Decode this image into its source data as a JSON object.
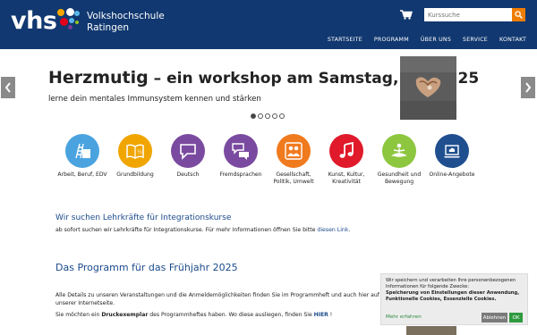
{
  "header": {
    "logo_text": "vhs",
    "school_line1": "Volkshochschule",
    "school_line2": "Ratingen",
    "search_placeholder": "Kurssuche"
  },
  "nav": {
    "items": [
      "STARTSEITE",
      "PROGRAMM",
      "ÜBER UNS",
      "SERVICE",
      "KONTAKT"
    ]
  },
  "slider": {
    "title_main": "Herzmutig",
    "title_rest": " – ein workshop am Samstag, 10.05.25",
    "subtitle": "lerne dein mentales Immunsystem kennen und stärken",
    "slide_count": 5,
    "active_slide": 1
  },
  "categories": [
    {
      "label": "Arbeit, Beruf, EDV",
      "color": "#4aa3df",
      "icon": "ladder-folder-icon"
    },
    {
      "label": "Grundbildung",
      "color": "#f0a500",
      "icon": "open-book-icon"
    },
    {
      "label": "Deutsch",
      "color": "#7a4aa0",
      "icon": "speech-bubble-icon"
    },
    {
      "label": "Fremdsprachen",
      "color": "#7a4aa0",
      "icon": "speech-bubbles-icon"
    },
    {
      "label": "Gesellschaft, Politik, Umwelt",
      "color": "#f07a1e",
      "icon": "people-icon"
    },
    {
      "label": "Kunst, Kultur, Kreativität",
      "color": "#e01a2a",
      "icon": "music-note-icon"
    },
    {
      "label": "Gesundheit und Bewegung",
      "color": "#8dc63f",
      "icon": "yoga-icon"
    },
    {
      "label": "Online-Angebote",
      "color": "#1f4f8f",
      "icon": "laptop-cloud-icon"
    }
  ],
  "teachers": {
    "title": "Wir suchen Lehrkräfte für Integrationskurse",
    "text": "ab sofort suchen wir Lehrkräfte für Integrationskurse. Für mehr Informationen öffnen Sie bitte ",
    "link": "diesen Link",
    "text_end": "."
  },
  "program": {
    "title": "Das Programm für das Frühjahr 2025",
    "text1": "Alle Details zu unseren Veranstaltungen und die Anmeldemöglichkeiten finden Sie im Programmheft und auch hier auf unserer Internetseite.",
    "text2_start": "Sie möchten ein ",
    "text2_bold": "Druckexemplar",
    "text2_mid": " des Programmheftes haben. Wo diese ausliegen, finden Sie ",
    "text2_link": "HIER",
    "text2_end": " !"
  },
  "cookie": {
    "text": "Wir speichern und verarbeiten Ihre personenbezogenen Informationen für folgende Zwecke:",
    "purposes": "Speicherung von Einstellungen dieser Anwendung, Funktionelle Cookies, Essenzielle Cookies.",
    "more": "Mehr erfahren",
    "decline": "Ablehnen",
    "ok": "OK"
  }
}
